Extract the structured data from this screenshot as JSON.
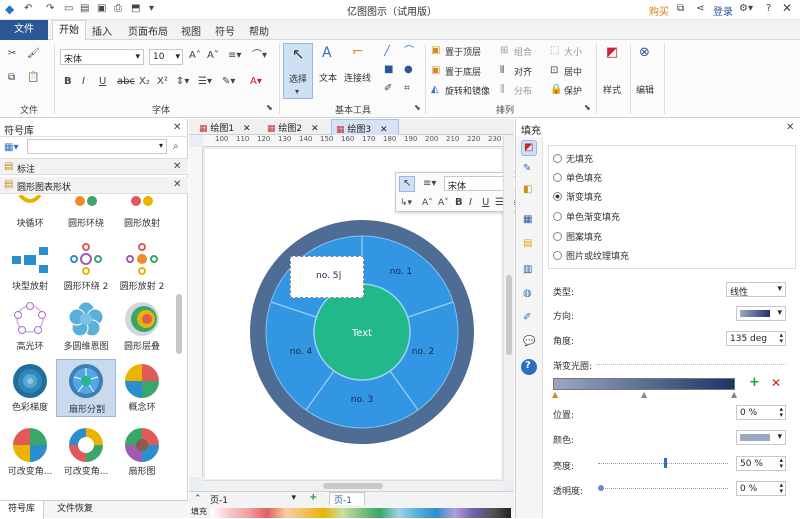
{
  "app": {
    "title": "亿图图示（试用版）"
  },
  "title_right": {
    "buy": "购买",
    "login": "登录"
  },
  "ribbon_tabs": [
    "文件",
    "开始",
    "插入",
    "页面布局",
    "视图",
    "符号",
    "帮助"
  ],
  "ribbon": {
    "groups": {
      "file": "文件",
      "font": "字体",
      "basic_tools": "基本工具",
      "arrange": "排列"
    },
    "font_name": "宋体",
    "font_size": "10",
    "tools": {
      "select": "选择",
      "text": "文本",
      "connector": "连接线"
    },
    "arrange": {
      "bring_front": "置于顶层",
      "send_back": "置于底层",
      "rotate": "旋转和镜像",
      "group": "组合",
      "align": "对齐",
      "distribute": "分布",
      "size": "大小",
      "center": "居中",
      "protect": "保护"
    },
    "style": "样式",
    "edit": "编辑"
  },
  "left_panel": {
    "title": "符号库",
    "categories": [
      "标注",
      "圆形图表形状"
    ],
    "items": [
      "块循环",
      "圆形环绕",
      "圆形放射",
      "块型放射",
      "圆形环绕 2",
      "圆形放射 2",
      "高光环",
      "多圆维恩图",
      "圆形层叠",
      "色彩梯度",
      "扇形分割",
      "概念环",
      "可改变角...",
      "可改变角...",
      "扇形图"
    ],
    "bottom_tabs": [
      "符号库",
      "文件恢复"
    ]
  },
  "doc_tabs": [
    "绘图1",
    "绘图2",
    "绘图3"
  ],
  "ruler_marks": [
    "100",
    "110",
    "120",
    "130",
    "140",
    "150",
    "160",
    "170",
    "180",
    "190",
    "200",
    "210",
    "220",
    "230"
  ],
  "diagram": {
    "center_text": "Text",
    "segments": [
      "no. 1",
      "no. 2",
      "no. 3",
      "no. 4",
      "no. 5|"
    ]
  },
  "float_toolbar": {
    "font": "宋体",
    "size": "10"
  },
  "page_bar": {
    "page_select": "页-1",
    "page_tab": "页-1",
    "fill_label": "填充"
  },
  "right_panel": {
    "title": "填充",
    "fill_options": [
      "无填充",
      "单色填充",
      "渐变填充",
      "单色渐变填充",
      "图案填充",
      "图片或纹理填充"
    ],
    "selected_index": 2,
    "type_label": "类型:",
    "type_value": "线性",
    "direction_label": "方向:",
    "angle_label": "角度:",
    "angle_value": "135 deg",
    "stops_label": "渐变光圈:",
    "position_label": "位置:",
    "position_value": "0 %",
    "color_label": "颜色:",
    "brightness_label": "亮度:",
    "brightness_value": "50 %",
    "transparency_label": "透明度:",
    "transparency_value": "0 %"
  },
  "colors": {
    "accent": "#2b5797",
    "outer_ring": "#4f6d94",
    "segments": "#3396e3",
    "center": "#21b98c",
    "gradient_start": "#9aa8c4",
    "gradient_end": "#1e3466"
  }
}
